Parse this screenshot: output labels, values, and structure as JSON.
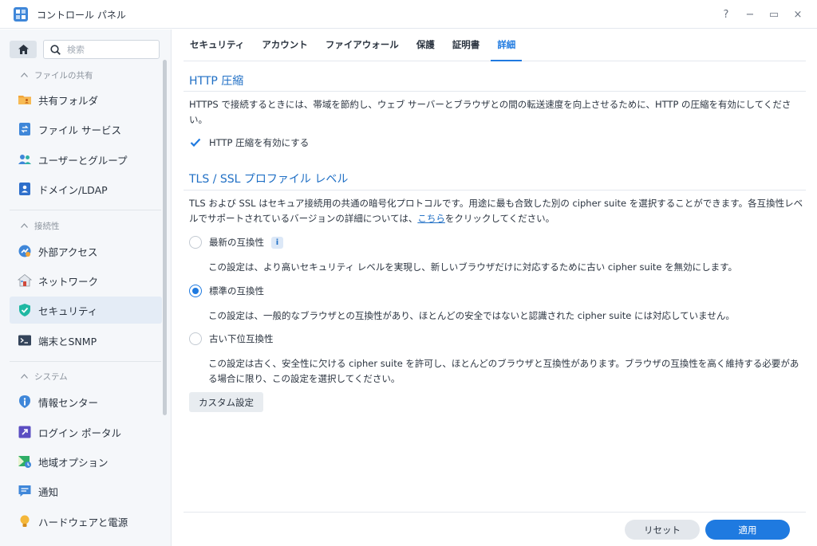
{
  "window": {
    "title": "コントロール パネル",
    "controls": {
      "help": "?",
      "minimize": "−",
      "maximize": "▭",
      "close": "×"
    }
  },
  "sidebar": {
    "search_placeholder": "検索",
    "sections": [
      {
        "header": "ファイルの共有",
        "items": [
          {
            "label": "共有フォルダ",
            "icon": "shared-folder-icon"
          },
          {
            "label": "ファイル サービス",
            "icon": "file-services-icon"
          },
          {
            "label": "ユーザーとグループ",
            "icon": "user-group-icon"
          },
          {
            "label": "ドメイン/LDAP",
            "icon": "domain-ldap-icon"
          }
        ]
      },
      {
        "header": "接続性",
        "items": [
          {
            "label": "外部アクセス",
            "icon": "external-access-icon"
          },
          {
            "label": "ネットワーク",
            "icon": "network-icon"
          },
          {
            "label": "セキュリティ",
            "icon": "security-shield-icon",
            "active": true
          },
          {
            "label": "端末とSNMP",
            "icon": "terminal-snmp-icon"
          }
        ]
      },
      {
        "header": "システム",
        "items": [
          {
            "label": "情報センター",
            "icon": "info-center-icon"
          },
          {
            "label": "ログイン ポータル",
            "icon": "login-portal-icon"
          },
          {
            "label": "地域オプション",
            "icon": "regional-options-icon"
          },
          {
            "label": "通知",
            "icon": "notification-icon"
          },
          {
            "label": "ハードウェアと電源",
            "icon": "hardware-power-icon"
          }
        ]
      }
    ]
  },
  "tabs": [
    {
      "label": "セキュリティ"
    },
    {
      "label": "アカウント"
    },
    {
      "label": "ファイアウォール"
    },
    {
      "label": "保護"
    },
    {
      "label": "証明書"
    },
    {
      "label": "詳細",
      "active": true
    }
  ],
  "http": {
    "title": "HTTP 圧縮",
    "description": "HTTPS で接続するときには、帯域を節約し、ウェブ サーバーとブラウザとの間の転送速度を向上させるために、HTTP の圧縮を有効にしてください。",
    "checkbox_label": "HTTP 圧縮を有効にする",
    "checked": true
  },
  "tls": {
    "title": "TLS / SSL プロファイル レベル",
    "description_before": "TLS および SSL はセキュア接続用の共通の暗号化プロトコルです。用途に最も合致した別の cipher suite を選択することができます。各互換性レベルでサポートされているバージョンの詳細については、",
    "link_text": "こちら",
    "description_after": "をクリックしてください。",
    "options": [
      {
        "label": "最新の互換性",
        "has_info": true,
        "info_glyph": "i",
        "desc": "この設定は、より高いセキュリティ レベルを実現し、新しいブラウザだけに対応するために古い cipher suite を無効にします。",
        "checked": false
      },
      {
        "label": "標準の互換性",
        "desc": "この設定は、一般的なブラウザとの互換性があり、ほとんどの安全ではないと認識された cipher suite には対応していません。",
        "checked": true
      },
      {
        "label": "古い下位互換性",
        "desc": "この設定は古く、安全性に欠ける cipher suite を許可し、ほとんどのブラウザと互換性があります。ブラウザの互換性を高く維持する必要がある場合に限り、この設定を選択してください。",
        "checked": false
      }
    ],
    "custom_button": "カスタム設定"
  },
  "footer": {
    "reset": "リセット",
    "apply": "適用"
  },
  "colors": {
    "accent": "#1f7ae0",
    "sidebar_bg": "#f5f7fa",
    "active_item_bg": "#e4ecf6"
  }
}
